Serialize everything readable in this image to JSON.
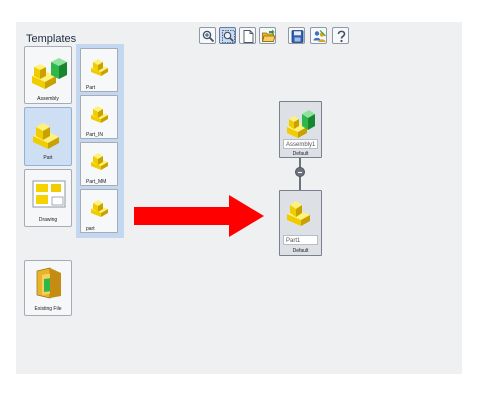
{
  "panel": {
    "heading": "Templates"
  },
  "toolbar": {
    "buttons": [
      {
        "icon": "zoom-in-icon",
        "active": false
      },
      {
        "icon": "zoom-fit-icon",
        "active": true
      },
      {
        "icon": "new-document-icon",
        "active": false
      },
      {
        "icon": "open-folder-icon",
        "active": false
      },
      {
        "icon": "save-icon",
        "active": false
      },
      {
        "icon": "users-icon",
        "active": false
      },
      {
        "icon": "help-icon",
        "active": false
      }
    ]
  },
  "templates": {
    "categories": [
      {
        "label": "Assembly",
        "icon": "assembly-icon",
        "selected": false
      },
      {
        "label": "Part",
        "icon": "part-icon",
        "selected": true
      },
      {
        "label": "Drawing",
        "icon": "drawing-icon",
        "selected": false
      },
      {
        "label": "Existing File",
        "icon": "folder-icon",
        "selected": false
      }
    ],
    "part_templates": [
      {
        "label": "Part",
        "icon": "part-icon"
      },
      {
        "label": "Part_IN",
        "icon": "part-icon"
      },
      {
        "label": "Part_MM",
        "icon": "part-icon"
      },
      {
        "label": "part",
        "icon": "part-icon"
      }
    ]
  },
  "arrow": {
    "color": "#ff0000",
    "icon": "arrow-right-icon"
  },
  "tree": {
    "nodes": [
      {
        "name": "Assembly1",
        "config": "Default",
        "icon": "assembly-icon"
      },
      {
        "name": "Part1",
        "config": "Default",
        "icon": "part-icon"
      }
    ],
    "collapse_icon": "collapse-icon"
  },
  "colors": {
    "selection": "#cfdff3",
    "panel": "#eff0f2",
    "part_yellow": "#f5d200",
    "assembly_green": "#2eb84a"
  }
}
